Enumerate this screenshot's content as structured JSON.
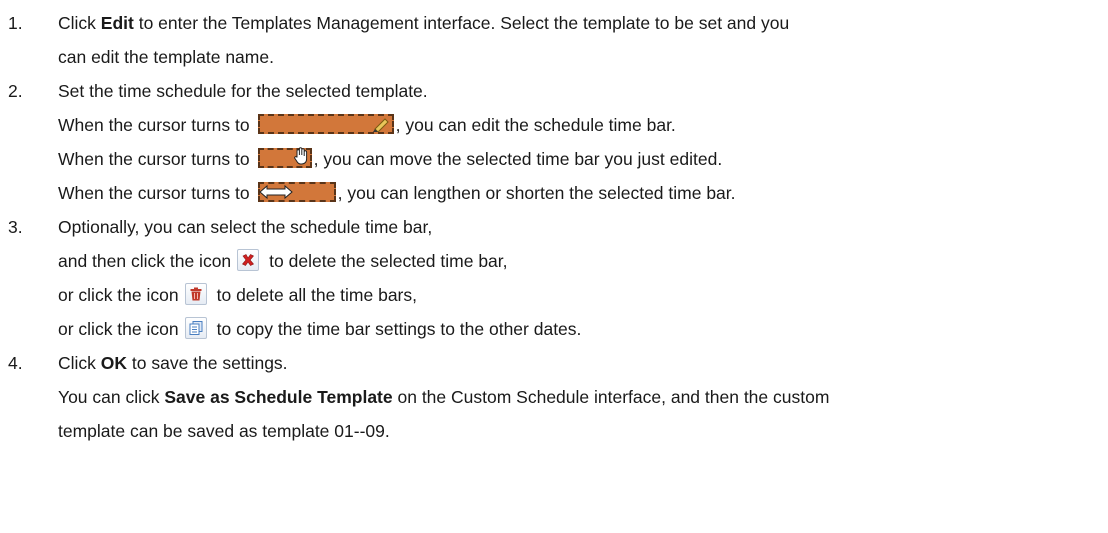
{
  "steps": [
    {
      "number": "1.",
      "line1": {
        "pre": "Click ",
        "bold": "Edit",
        "post": " to enter the Templates Management interface. Select the template to be set and you"
      },
      "line2": "can edit the template name."
    },
    {
      "number": "2.",
      "line1": "Set the time schedule for the selected template.",
      "cursor_edit": {
        "pre": "When the cursor turns to",
        "post": ", you can edit the schedule time bar."
      },
      "cursor_move": {
        "pre": "When the cursor turns to",
        "post": ", you can move the selected time bar you just edited."
      },
      "cursor_resize": {
        "pre": "When the cursor turns to",
        "post": ", you can lengthen or shorten the selected time bar."
      }
    },
    {
      "number": "3.",
      "line1": "Optionally, you can select the schedule time bar,",
      "delete_one": {
        "pre": "and then click the icon",
        "post": "to delete the selected time bar,"
      },
      "delete_all": {
        "pre": "or click the icon",
        "post": "to delete all the time bars,"
      },
      "copy": {
        "pre": "or click the icon",
        "post": "to copy the time bar settings to the other dates."
      }
    },
    {
      "number": "4.",
      "line1": {
        "pre": "Click ",
        "bold": "OK",
        "post": " to save the settings."
      },
      "line2": {
        "pre": "You can click ",
        "bold": "Save as Schedule Template",
        "post": " on the Custom Schedule interface, and then the custom"
      },
      "line3": "template can be saved as template 01--09."
    }
  ],
  "icons": {
    "pencil": "pencil-icon",
    "hand": "hand-cursor-icon",
    "resize": "resize-arrows-icon",
    "delete": "delete-x-icon",
    "trash": "trash-icon",
    "copy": "copy-icon"
  },
  "colors": {
    "time_bar": "#d2773a",
    "time_bar_border": "#5a3418",
    "delete_red": "#d02020",
    "trash_red": "#c0392b",
    "copy_blue": "#4a7fc1"
  }
}
